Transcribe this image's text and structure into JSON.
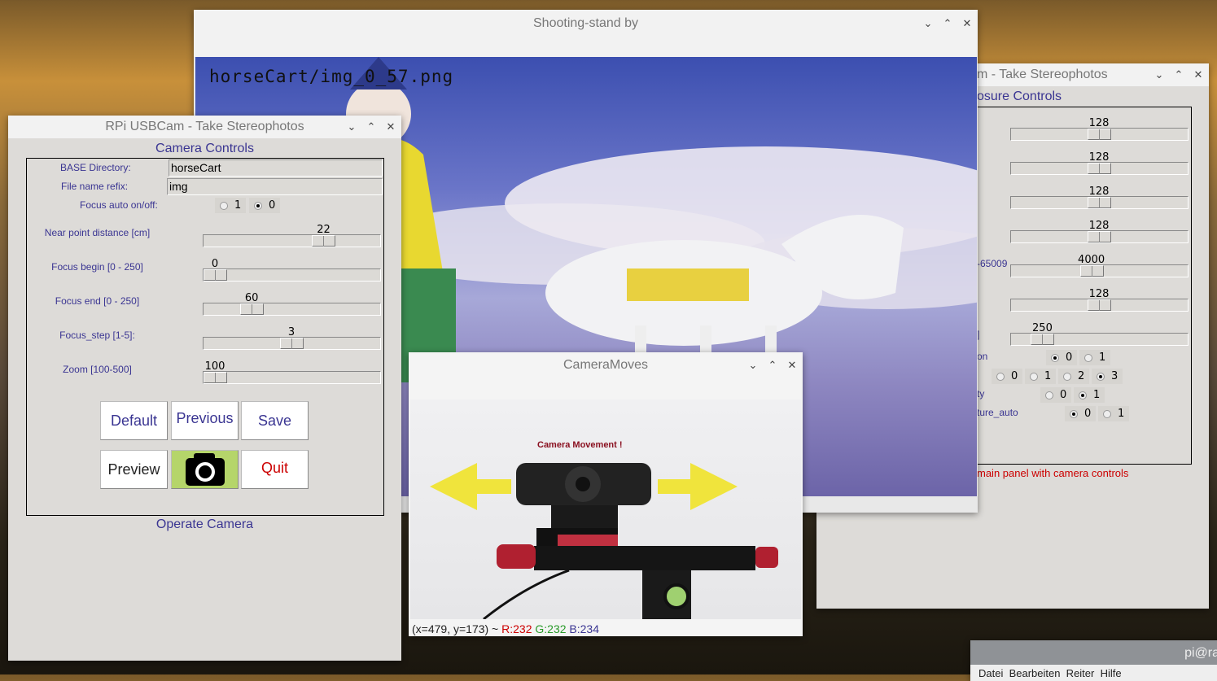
{
  "shooting_stand": {
    "title": "Shooting-stand by",
    "filename": "horseCart/img_0_57.png"
  },
  "right_window": {
    "title_fragment": "m - Take Stereophotos",
    "header_fragment": "osure Controls",
    "sliders": [
      {
        "value": "128",
        "pos": 0.5
      },
      {
        "value": "128",
        "pos": 0.5
      },
      {
        "value": "128",
        "pos": 0.5
      },
      {
        "value": "128",
        "pos": 0.5
      },
      {
        "value": "4000",
        "pos": 0.45,
        "label": "-65009"
      },
      {
        "value": "128",
        "pos": 0.5
      },
      {
        "value": "250",
        "pos": 0.13,
        "label": "]"
      }
    ],
    "radio_rows": [
      {
        "label": "on",
        "options": [
          "0",
          "1"
        ],
        "selected": "0"
      },
      {
        "label": "",
        "options": [
          "0",
          "1",
          "2",
          "3"
        ],
        "selected": "3"
      },
      {
        "label": "ty",
        "options": [
          "0",
          "1"
        ],
        "selected": "1"
      },
      {
        "label": "ture_auto",
        "options": [
          "0",
          "1"
        ],
        "selected": "0"
      }
    ],
    "status": "main panel with camera controls"
  },
  "left_window": {
    "title": "RPi USBCam - Take Stereophotos",
    "header": "Camera Controls",
    "base_dir_label": "BASE Directory:",
    "base_dir_value": "horseCart",
    "prefix_label": "File name refix:",
    "prefix_value": "img",
    "focus_auto_label": "Focus auto on/off:",
    "focus_auto_options": [
      "1",
      "0"
    ],
    "focus_auto_selected": "0",
    "sliders": [
      {
        "label": "Near point distance [cm]",
        "value": "22",
        "pos": 0.71
      },
      {
        "label": "Focus begin [0 - 250]",
        "value": "0",
        "pos": 0
      },
      {
        "label": "Focus end [0 - 250]",
        "value": "60",
        "pos": 0.24
      },
      {
        "label": "Focus_step [1-5]:",
        "value": "3",
        "pos": 0.5
      },
      {
        "label": "Zoom [100-500]",
        "value": "100",
        "pos": 0
      }
    ],
    "buttons": {
      "default": "Default",
      "previous": "Previous",
      "save": "Save",
      "preview": "Preview",
      "quit": "Quit"
    },
    "footer": "Operate Camera",
    "colors": {
      "label": "#3a3592",
      "quit": "#cc0000",
      "shutter_bg": "#b5d56a"
    }
  },
  "camera_moves": {
    "title": "CameraMoves",
    "caption": "Camera Movement !",
    "status": {
      "coords": "(x=479, y=173) ~",
      "r": "R:232",
      "g": "G:232",
      "b": "B:234"
    }
  },
  "terminal": {
    "title": "pi@ra",
    "menu": "Datei  Bearbeiten  Reiter  Hilfe"
  },
  "controls": {
    "minimize": "⌄",
    "maximize": "⌃",
    "close": "✕"
  }
}
